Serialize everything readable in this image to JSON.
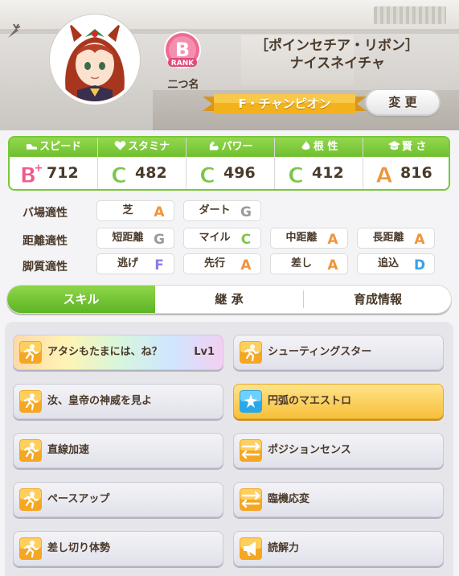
{
  "character": {
    "epithet": "［ポインセチア・リボン］",
    "name": "ナイスネイチャ",
    "rank_letter": "B",
    "rank_word": "RANK",
    "rank_sub": "二つ名",
    "title": "F・チャンピオン",
    "change_label": "変 更"
  },
  "stats": [
    {
      "label": "スピード",
      "icon": "shoe-icon",
      "grade": "B+",
      "value": "712"
    },
    {
      "label": "スタミナ",
      "icon": "heart-icon",
      "grade": "C",
      "value": "482"
    },
    {
      "label": "パワー",
      "icon": "muscle-icon",
      "grade": "C",
      "value": "496"
    },
    {
      "label": "根 性",
      "icon": "flame-icon",
      "grade": "C",
      "value": "412"
    },
    {
      "label": "賢 さ",
      "icon": "cap-icon",
      "grade": "A",
      "value": "816"
    }
  ],
  "aptitude": {
    "track": {
      "label": "バ場適性",
      "items": [
        {
          "name": "芝",
          "grade": "A"
        },
        {
          "name": "ダート",
          "grade": "G"
        }
      ]
    },
    "distance": {
      "label": "距離適性",
      "items": [
        {
          "name": "短距離",
          "grade": "G"
        },
        {
          "name": "マイル",
          "grade": "C"
        },
        {
          "name": "中距離",
          "grade": "A"
        },
        {
          "name": "長距離",
          "grade": "A"
        }
      ]
    },
    "style": {
      "label": "脚質適性",
      "items": [
        {
          "name": "逃げ",
          "grade": "F"
        },
        {
          "name": "先行",
          "grade": "A"
        },
        {
          "name": "差し",
          "grade": "A"
        },
        {
          "name": "追込",
          "grade": "D"
        }
      ]
    }
  },
  "tabs": [
    {
      "label": "スキル",
      "active": true
    },
    {
      "label": "継 承",
      "active": false
    },
    {
      "label": "育成情報",
      "active": false
    }
  ],
  "skills": [
    {
      "name": "アタシもたまには、ね？",
      "level": "Lv1",
      "type": "unique",
      "icon": "runner-icon"
    },
    {
      "name": "シューティングスター",
      "type": "normal",
      "icon": "runner-icon"
    },
    {
      "name": "汝、皇帝の神威を見よ",
      "type": "normal",
      "icon": "runner-icon"
    },
    {
      "name": "円弧のマエストロ",
      "type": "gold",
      "icon": "recovery-icon"
    },
    {
      "name": "直線加速",
      "type": "normal",
      "icon": "runner-icon"
    },
    {
      "name": "ポジションセンス",
      "type": "normal",
      "icon": "arrows-icon"
    },
    {
      "name": "ペースアップ",
      "type": "normal",
      "icon": "runner-icon"
    },
    {
      "name": "臨機応変",
      "type": "normal",
      "icon": "arrows-icon"
    },
    {
      "name": "差し切り体勢",
      "type": "normal",
      "icon": "runner-icon"
    },
    {
      "name": "読解力",
      "type": "normal",
      "icon": "megaphone-icon"
    }
  ],
  "colors": {
    "accent_green": "#6fbf2f",
    "grade_a": "#f0943a",
    "grade_b": "#ef5a8a",
    "grade_c": "#7cc64a",
    "grade_d": "#3aa0e8",
    "grade_f": "#8a7ce8",
    "grade_g": "#9a9a9a",
    "title_gold": "#f3b11b"
  }
}
